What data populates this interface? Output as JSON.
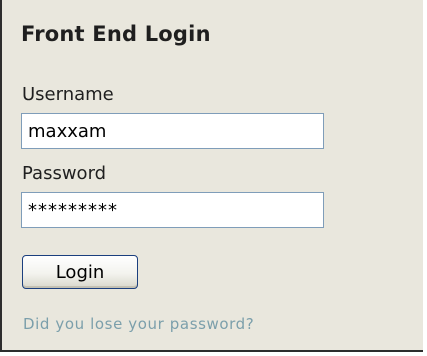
{
  "login_module": {
    "title": "Front End Login",
    "username": {
      "label": "Username",
      "value": "maxxam"
    },
    "password": {
      "label": "Password",
      "value": "*********"
    },
    "submit_label": "Login",
    "lost_password_link": "Did you lose your password?"
  },
  "colors": {
    "panel_background": "#e9e7dd",
    "input_border": "#7f9db9",
    "button_border": "#1b3f7e",
    "link": "#7b9fab"
  }
}
